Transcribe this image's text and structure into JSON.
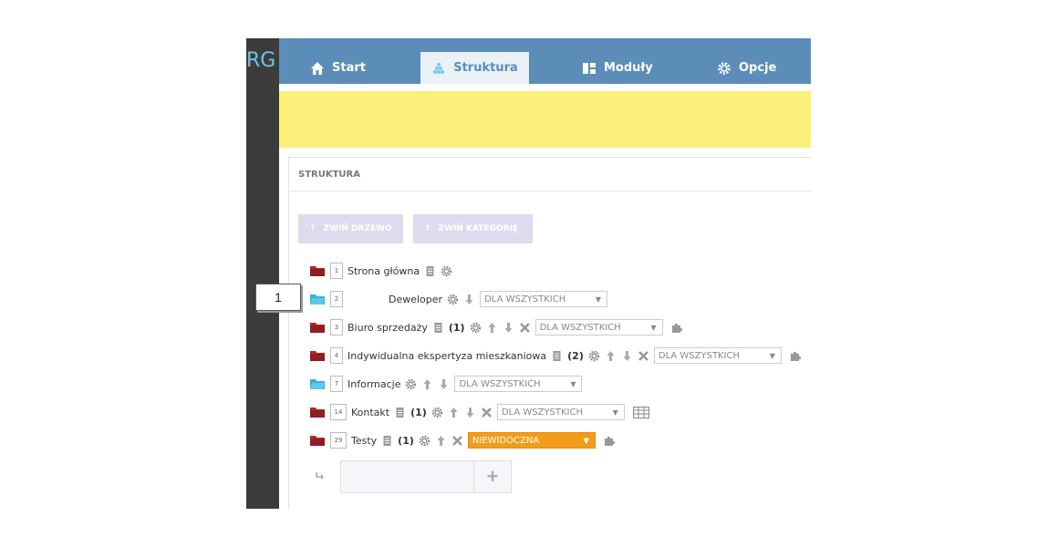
{
  "brand": {
    "text": "RG"
  },
  "nav": {
    "tabs": [
      {
        "label": "Start",
        "icon": "home-icon"
      },
      {
        "label": "Struktura",
        "icon": "tree-icon",
        "active": true
      },
      {
        "label": "Moduły",
        "icon": "modules-icon"
      },
      {
        "label": "Opcje",
        "icon": "gear-icon"
      }
    ]
  },
  "panel": {
    "title": "STRUKTURA",
    "collapse_tree_label": "ZWIŃ DRZEWO",
    "collapse_category_label": "ZWIŃ KATEGORIĘ"
  },
  "callout": {
    "label": "1"
  },
  "rows": [
    {
      "num": "1",
      "label": "Strona główna",
      "folder": "red",
      "count": "",
      "visibility": ""
    },
    {
      "num": "2",
      "label": "Deweloper",
      "folder": "blue",
      "count": "",
      "visibility": "DLA WSZYSTKICH"
    },
    {
      "num": "3",
      "label": "Biuro sprzedaży",
      "folder": "red",
      "count": "(1)",
      "visibility": "DLA WSZYSTKICH"
    },
    {
      "num": "4",
      "label": "Indywidualna ekspertyza mieszkaniowa",
      "folder": "red",
      "count": "(2)",
      "visibility": "DLA WSZYSTKICH"
    },
    {
      "num": "7",
      "label": "Informacje",
      "folder": "blue",
      "count": "",
      "visibility": "DLA WSZYSTKICH"
    },
    {
      "num": "14",
      "label": "Kontakt",
      "folder": "red",
      "count": "(1)",
      "visibility": "DLA WSZYSTKICH"
    },
    {
      "num": "29",
      "label": "Testy",
      "folder": "red",
      "count": "(1)",
      "visibility": "NIEWIDOCZNA"
    }
  ],
  "colors": {
    "nav_bg": "#5b8db8",
    "banner": "#faf07a",
    "folder_red": "#b3282d",
    "folder_blue": "#37b3d9",
    "hidden_badge": "#f29c1a"
  }
}
